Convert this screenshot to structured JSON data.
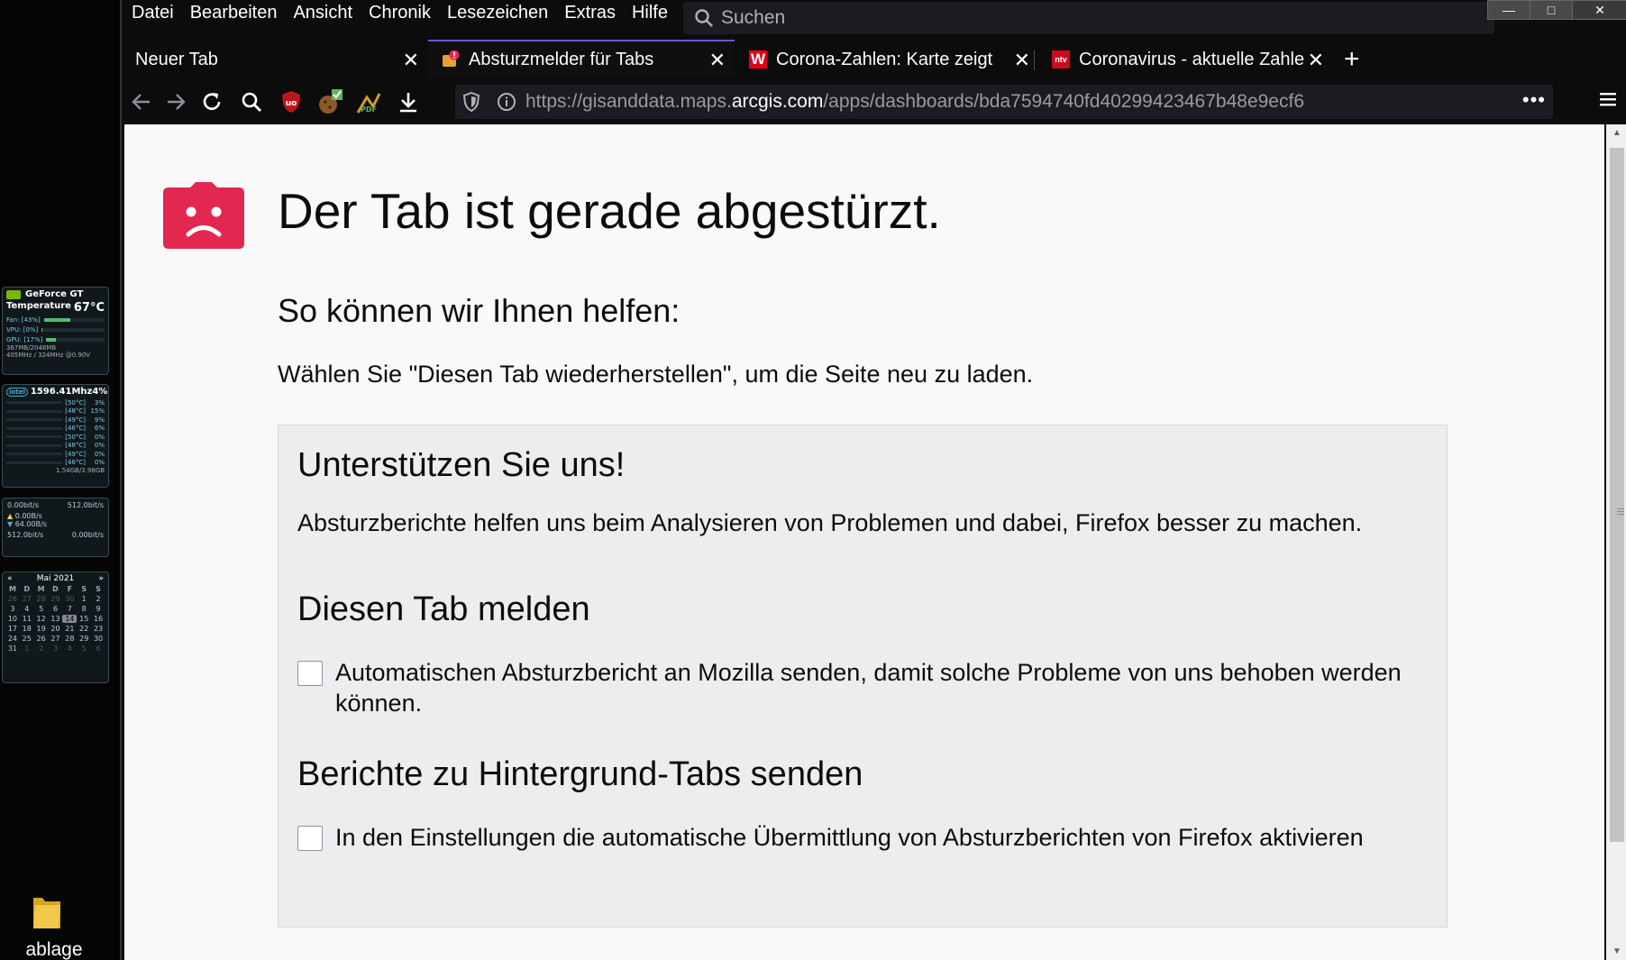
{
  "desktop": {
    "gpu_widget": {
      "name": "GeForce GT",
      "temperature_label": "Temperature",
      "temperature_value": "67°C",
      "rows": [
        {
          "label": "Fan: [43%]",
          "level": 0.43
        },
        {
          "label": "VPU: [0%]",
          "level": 0.0
        },
        {
          "label": "GPU: [17%]",
          "level": 0.17
        }
      ],
      "memory": "367MB/2048MB",
      "clock": "405MHz / 324MHz @0.90V"
    },
    "cpu_widget": {
      "frequency": "1596.41Mhz",
      "usage": "4%",
      "cores": [
        {
          "temp": "[50°C]",
          "load": "3%"
        },
        {
          "temp": "[48°C]",
          "load": "15%"
        },
        {
          "temp": "[49°C]",
          "load": "9%"
        },
        {
          "temp": "[46°C]",
          "load": "6%"
        },
        {
          "temp": "[50°C]",
          "load": "0%"
        },
        {
          "temp": "[48°C]",
          "load": "0%"
        },
        {
          "temp": "[49°C]",
          "load": "0%"
        },
        {
          "temp": "[46°C]",
          "load": "0%"
        }
      ],
      "memory": "1.54GB/3.98GB"
    },
    "net_widget": {
      "top_left": "0.00bit/s",
      "top_right": "512.0bit/s",
      "up": "0.00B/s",
      "down": "64.00B/s",
      "bottom_left": "512.0bit/s",
      "bottom_right": "0.00bit/s"
    },
    "calendar": {
      "month": "Mai 2021",
      "prev": "«",
      "next": "»",
      "weekdays": [
        "M",
        "D",
        "M",
        "D",
        "F",
        "S",
        "S"
      ],
      "days": [
        {
          "d": "26",
          "dim": true
        },
        {
          "d": "27",
          "dim": true
        },
        {
          "d": "28",
          "dim": true
        },
        {
          "d": "29",
          "dim": true
        },
        {
          "d": "30",
          "dim": true
        },
        {
          "d": "1"
        },
        {
          "d": "2"
        },
        {
          "d": "3"
        },
        {
          "d": "4"
        },
        {
          "d": "5"
        },
        {
          "d": "6"
        },
        {
          "d": "7"
        },
        {
          "d": "8"
        },
        {
          "d": "9"
        },
        {
          "d": "10"
        },
        {
          "d": "11"
        },
        {
          "d": "12"
        },
        {
          "d": "13"
        },
        {
          "d": "14",
          "today": true
        },
        {
          "d": "15"
        },
        {
          "d": "16"
        },
        {
          "d": "17"
        },
        {
          "d": "18"
        },
        {
          "d": "19"
        },
        {
          "d": "20"
        },
        {
          "d": "21"
        },
        {
          "d": "22"
        },
        {
          "d": "23"
        },
        {
          "d": "24"
        },
        {
          "d": "25"
        },
        {
          "d": "26"
        },
        {
          "d": "27"
        },
        {
          "d": "28"
        },
        {
          "d": "29"
        },
        {
          "d": "30"
        },
        {
          "d": "31"
        },
        {
          "d": "1",
          "dim": true
        },
        {
          "d": "2",
          "dim": true
        },
        {
          "d": "3",
          "dim": true
        },
        {
          "d": "4",
          "dim": true
        },
        {
          "d": "5",
          "dim": true
        },
        {
          "d": "6",
          "dim": true
        }
      ]
    },
    "folder_label": "ablage"
  },
  "browser": {
    "menu": [
      "Datei",
      "Bearbeiten",
      "Ansicht",
      "Chronik",
      "Lesezeichen",
      "Extras",
      "Hilfe"
    ],
    "search_placeholder": "Suchen",
    "window_controls": {
      "minimize": "—",
      "maximize": "□",
      "close": "✕"
    },
    "tabs": [
      {
        "title": "Neuer Tab",
        "active": false
      },
      {
        "title": "Absturzmelder für Tabs",
        "active": true
      },
      {
        "title": "Corona-Zahlen: Karte zeigt a",
        "active": false
      },
      {
        "title": "Coronavirus - aktuelle Zahle",
        "active": false
      }
    ],
    "new_tab_label": "+",
    "close_glyph": "✕",
    "url": {
      "prefix": "https://gisanddata.maps.",
      "domain": "arcgis.com",
      "path": "/apps/dashboards/bda7594740fd40299423467b48e9ecf6"
    },
    "page_actions": "•••",
    "accent": "#6e56cf"
  },
  "page": {
    "title": "Der Tab ist gerade abgestürzt.",
    "help_heading": "So können wir Ihnen helfen:",
    "help_text": "Wählen Sie \"Diesen Tab wiederherstellen\", um die Seite neu zu laden.",
    "support_heading": "Unterstützen Sie uns!",
    "support_text": "Absturzberichte helfen uns beim Analysieren von Problemen und dabei, Firefox besser zu machen.",
    "report_heading": "Diesen Tab melden",
    "report_checkbox": "Automatischen Absturzbericht an Mozilla senden, damit solche Probleme von uns behoben werden können.",
    "report_checked": false,
    "background_heading": "Berichte zu Hintergrund-Tabs senden",
    "background_checkbox": "In den Einstellungen die automatische Übermittlung von Absturzberichten von Firefox aktivieren",
    "background_checked": false,
    "sad_icon_color": "#e22850"
  }
}
